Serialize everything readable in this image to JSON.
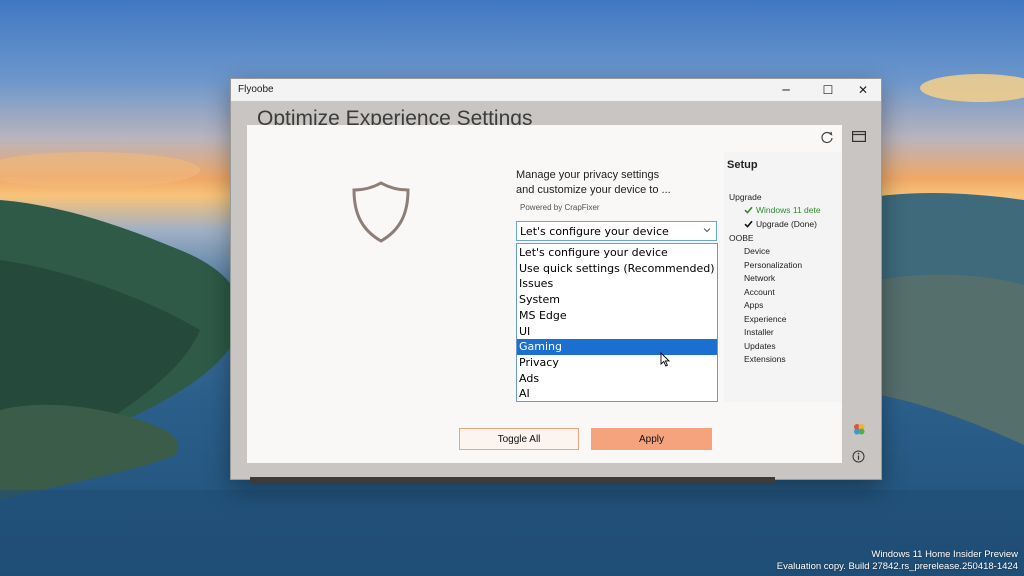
{
  "window": {
    "title": "Flyoobe",
    "controls": {
      "minimize": "─",
      "maximize": "☐",
      "close": "✕"
    }
  },
  "page": {
    "heading": "Optimize Experience Settings",
    "description_line1": "Manage your privacy settings",
    "description_line2": "and customize your device to ...",
    "powered_by": "Powered by CrapFixer"
  },
  "category_select": {
    "value": "Let's configure your device",
    "options": [
      "Let's configure your device",
      "Use quick settings (Recommended)",
      "Issues",
      "System",
      "MS Edge",
      "UI",
      "Gaming",
      "Privacy",
      "Ads",
      "AI"
    ],
    "highlighted": "Gaming"
  },
  "buttons": {
    "toggle_all": "Toggle All",
    "apply": "Apply"
  },
  "setup": {
    "title": "Setup",
    "upgrade_label": "Upgrade",
    "upgrade_steps": [
      {
        "label": "Windows 11 dete",
        "status": "green"
      },
      {
        "label": "Upgrade (Done)",
        "status": "done"
      }
    ],
    "oobe_label": "OOBE",
    "oobe_steps": [
      "Device",
      "Personalization",
      "Network",
      "Account",
      "Apps",
      "Experience",
      "Installer",
      "Updates",
      "Extensions"
    ]
  },
  "desktop": {
    "watermark_line1": "Windows 11 Home Insider Preview",
    "watermark_line2": "Evaluation copy. Build 27842.rs_prerelease.250418-1424"
  },
  "colors": {
    "accent_orange": "#f4a37c",
    "selection_blue": "#1a6fd0",
    "success_green": "#2a8f2a"
  },
  "icons": {
    "shield": "shield-icon",
    "refresh": "refresh-icon",
    "sidebar_toggle": "sidebar-toggle-icon",
    "palette": "palette-icon",
    "info": "info-icon",
    "check": "check-icon"
  }
}
